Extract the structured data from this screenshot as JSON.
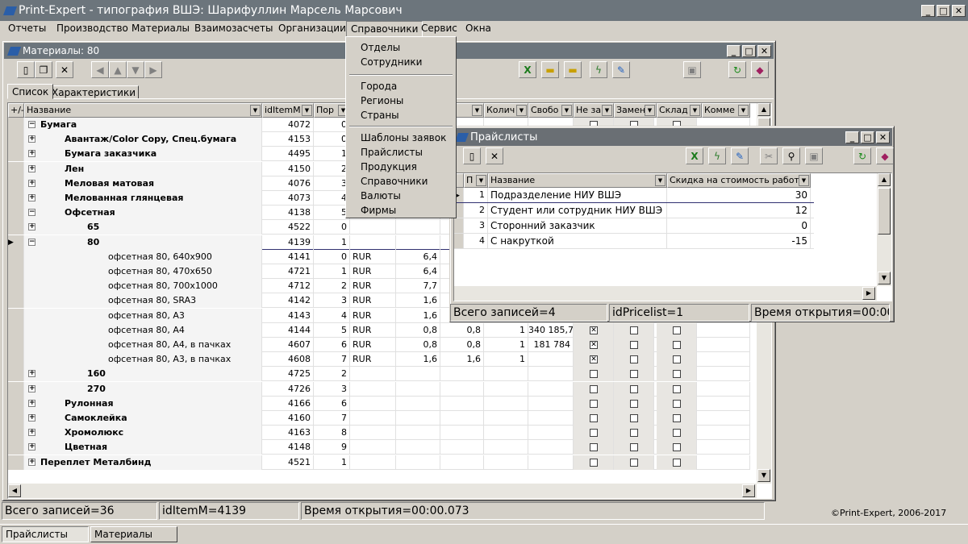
{
  "app": {
    "title": "Print-Expert - типография ВШЭ: Шарифуллин Марсель Марсович",
    "menu": [
      "Отчеты",
      "Производство",
      "Материалы",
      "Взаимозасчеты",
      "Организации",
      "Справочники",
      "Сервис",
      "Окна"
    ],
    "copyright": "©Print-Expert, 2006-2017",
    "taskbar": [
      "Прайслисты",
      "Материалы"
    ]
  },
  "dropdown": {
    "groups": [
      [
        "Отделы",
        "Сотрудники"
      ],
      [
        "Города",
        "Регионы",
        "Страны"
      ],
      [
        "Шаблоны заявок",
        "Прайслисты",
        "Продукция",
        "Справочники",
        "Валюты",
        "Фирмы"
      ]
    ]
  },
  "materials": {
    "title": "Материалы: 80",
    "tabs": [
      "Список",
      "Характеристики"
    ],
    "columns": [
      "+/-",
      "Название",
      "idItemM",
      "Пор",
      "",
      "",
      "мм",
      "Колич",
      "Свобо",
      "Не зака",
      "Замена",
      "Склад",
      "Комме"
    ],
    "rows": [
      {
        "name": "Бумага",
        "id": "4072",
        "por": "0",
        "level": 0,
        "bold": true,
        "exp": "−"
      },
      {
        "name": "Авантаж/Color Copy, Спец.бумага",
        "id": "4153",
        "por": "0",
        "level": 1,
        "bold": true,
        "exp": "+"
      },
      {
        "name": "Бумага заказчика",
        "id": "4495",
        "por": "1",
        "level": 1,
        "bold": true,
        "exp": "+"
      },
      {
        "name": "Лен",
        "id": "4150",
        "por": "2",
        "level": 1,
        "bold": true,
        "exp": "+"
      },
      {
        "name": "Меловая матовая",
        "id": "4076",
        "por": "3",
        "level": 1,
        "bold": true,
        "exp": "+"
      },
      {
        "name": "Мелованная глянцевая",
        "id": "4073",
        "por": "4",
        "level": 1,
        "bold": true,
        "exp": "+"
      },
      {
        "name": "Офсетная",
        "id": "4138",
        "por": "5",
        "level": 1,
        "bold": true,
        "exp": "−"
      },
      {
        "name": "65",
        "id": "4522",
        "por": "0",
        "level": 2,
        "bold": true,
        "exp": "+"
      },
      {
        "name": "80",
        "id": "4139",
        "por": "1",
        "level": 2,
        "bold": true,
        "exp": "−",
        "selected": true
      },
      {
        "name": "офсетная 80, 640х900",
        "id": "4141",
        "por": "0",
        "cur": "RUR",
        "p": "6,4",
        "level": 3
      },
      {
        "name": "офсетная 80, 470х650",
        "id": "4721",
        "por": "1",
        "cur": "RUR",
        "p": "6,4",
        "level": 3
      },
      {
        "name": "офсетная 80, 700х1000",
        "id": "4712",
        "por": "2",
        "cur": "RUR",
        "p": "7,7",
        "level": 3
      },
      {
        "name": "офсетная 80, SRA3",
        "id": "4142",
        "por": "3",
        "cur": "RUR",
        "p": "1,6",
        "level": 3
      },
      {
        "name": "офсетная 80, А3",
        "id": "4143",
        "por": "4",
        "cur": "RUR",
        "p": "1,6",
        "level": 3
      },
      {
        "name": "офсетная 80, А4",
        "id": "4144",
        "por": "5",
        "cur": "RUR",
        "p": "0,8",
        "p2": "0,8",
        "q": "1",
        "free": "340 185,71",
        "level": 3,
        "chk": true
      },
      {
        "name": "офсетная 80, А4, в пачках",
        "id": "4607",
        "por": "6",
        "cur": "RUR",
        "p": "0,8",
        "p2": "0,8",
        "q": "1",
        "free": "181 784",
        "level": 3,
        "chk": true
      },
      {
        "name": "офсетная 80, А3, в пачках",
        "id": "4608",
        "por": "7",
        "cur": "RUR",
        "p": "1,6",
        "p2": "1,6",
        "q": "1",
        "level": 3,
        "chk": true
      },
      {
        "name": "160",
        "id": "4725",
        "por": "2",
        "level": 2,
        "bold": true,
        "exp": "+"
      },
      {
        "name": "270",
        "id": "4726",
        "por": "3",
        "level": 2,
        "bold": true,
        "exp": "+"
      },
      {
        "name": "Рулонная",
        "id": "4166",
        "por": "6",
        "level": 1,
        "bold": true,
        "exp": "+"
      },
      {
        "name": "Самоклейка",
        "id": "4160",
        "por": "7",
        "level": 1,
        "bold": true,
        "exp": "+"
      },
      {
        "name": "Хромолюкс",
        "id": "4163",
        "por": "8",
        "level": 1,
        "bold": true,
        "exp": "+"
      },
      {
        "name": "Цветная",
        "id": "4148",
        "por": "9",
        "level": 1,
        "bold": true,
        "exp": "+"
      },
      {
        "name": "Переплет Металбинд",
        "id": "4521",
        "por": "1",
        "level": 0,
        "bold": true,
        "exp": "+"
      }
    ],
    "status": [
      "Всего записей=36",
      "idItemM=4139",
      "Время открытия=00:00.073"
    ]
  },
  "pricelists": {
    "title": "Прайслисты",
    "columns": [
      "П",
      "Название",
      "Скидка на стоимость работ"
    ],
    "rows": [
      {
        "n": "1",
        "name": "Подразделение НИУ ВШЭ",
        "disc": "30"
      },
      {
        "n": "2",
        "name": "Студент или сотрудник НИУ ВШЭ",
        "disc": "12"
      },
      {
        "n": "3",
        "name": "Сторонний заказчик",
        "disc": "0"
      },
      {
        "n": "4",
        "name": "С накруткой",
        "disc": "-15"
      }
    ],
    "status": [
      "Всего записей=4",
      "idPricelist=1",
      "Время открытия=00:00"
    ]
  }
}
